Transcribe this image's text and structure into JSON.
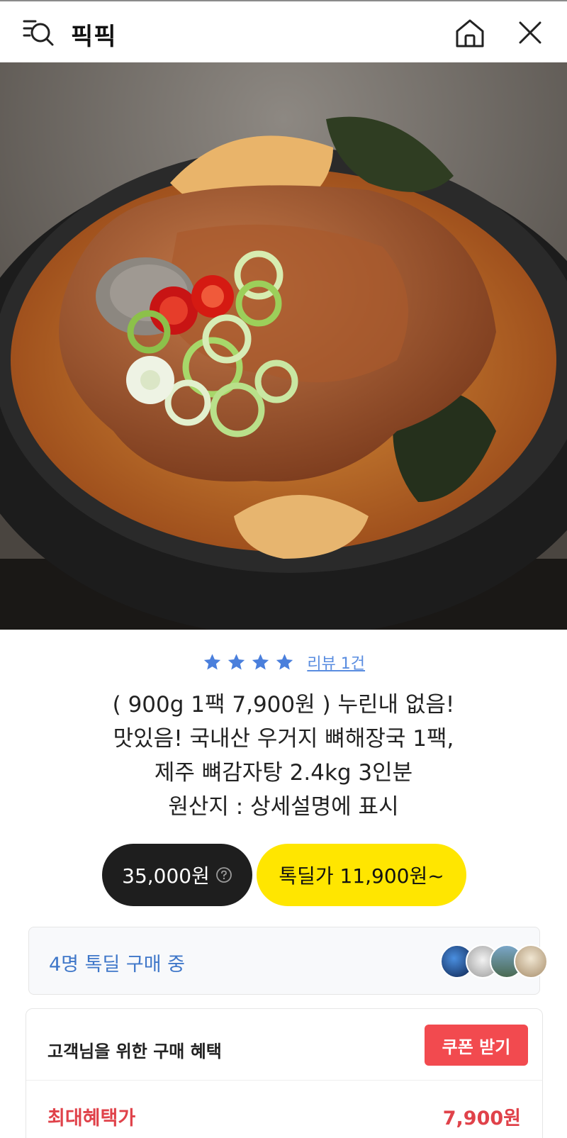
{
  "header": {
    "title": "픽픽",
    "menu_icon": "menu-search-icon",
    "home_icon": "home-icon",
    "close_icon": "close-icon"
  },
  "product": {
    "image_icon": "food-photo",
    "rating": 4,
    "review_link": "리뷰 1건",
    "title_lines": [
      "( 900g 1팩 7,900원 ) 누린내 없음!",
      "맛있음! 국내산 우거지 뼈해장국 1팩,",
      "제주 뼈감자탕 2.4kg 3인분",
      "원산지 : 상세설명에 표시"
    ],
    "price": "35,000원",
    "deal_price": "톡딜가 11,900원~"
  },
  "buyers": {
    "text": "4명 톡딜 구매 중"
  },
  "benefits": {
    "title": "고객님을 위한 구매 혜택",
    "coupon_button": "쿠폰 받기",
    "max_label": "최대혜택가",
    "max_price": "7,900원"
  },
  "colors": {
    "accent_blue": "#3f77c9",
    "star_blue": "#4a7fdc",
    "deal_yellow": "#ffe600",
    "coupon_red": "#f24a4f"
  }
}
